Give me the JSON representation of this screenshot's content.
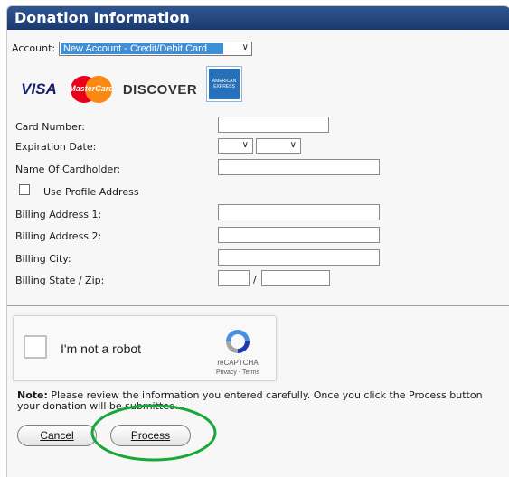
{
  "panel": {
    "title": "Donation Information"
  },
  "account": {
    "label": "Account:",
    "selected": "New Account - Credit/Debit Card"
  },
  "card_logos": {
    "visa": "VISA",
    "mastercard": "MasterCard",
    "discover": "DISCOVER",
    "amex": "AMERICAN EXPRESS"
  },
  "form": {
    "card_number_label": "Card Number:",
    "expiration_label": "Expiration Date:",
    "cardholder_label": "Name Of Cardholder:",
    "use_profile_label": "Use Profile Address",
    "billing1_label": "Billing Address 1:",
    "billing2_label": "Billing Address 2:",
    "city_label": "Billing City:",
    "state_zip_label": "Billing State / Zip:",
    "state_zip_separator": "/"
  },
  "captcha": {
    "text": "I'm not a robot",
    "brand": "reCAPTCHA",
    "links": "Privacy - Terms"
  },
  "note": {
    "label": "Note:",
    "text": "Please review the information you entered carefully. Once you click the Process button your donation will be submitted."
  },
  "buttons": {
    "cancel": "Cancel",
    "process": "Process"
  },
  "colors": {
    "header": "#1b3a6e",
    "highlight_circle": "#18a83a",
    "selected_option": "#3e8fd8"
  }
}
